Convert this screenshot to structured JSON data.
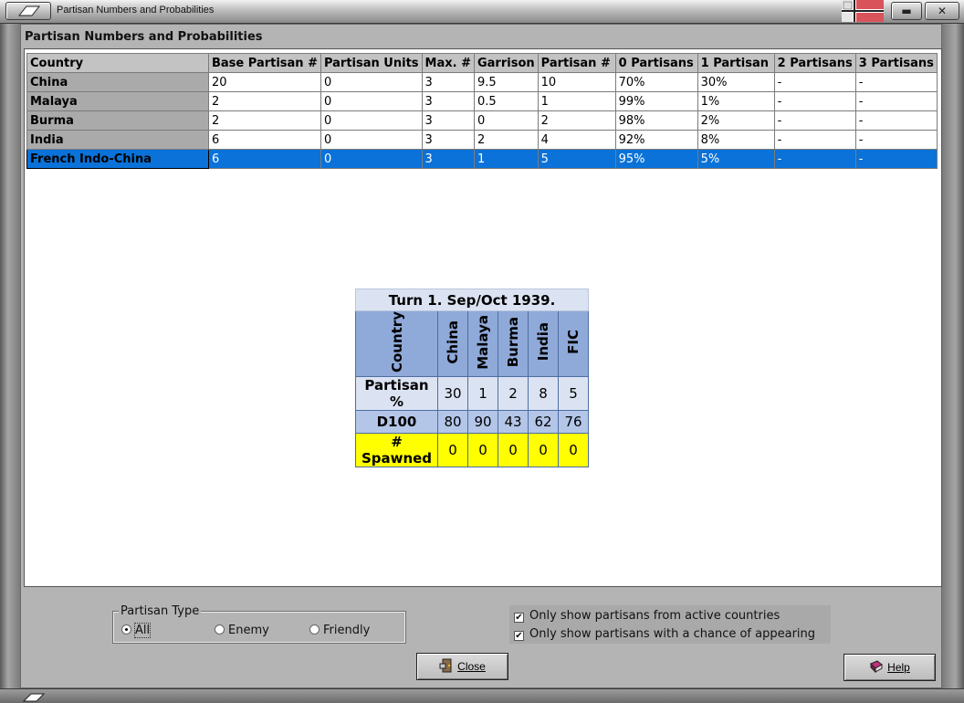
{
  "window": {
    "title": "Partisan Numbers and Probabilities",
    "min_glyph": "▬",
    "close_glyph": "✕"
  },
  "panel": {
    "heading": "Partisan Numbers and Probabilities"
  },
  "grid": {
    "columns": [
      "Country",
      "Base Partisan #",
      "Partisan Units",
      "Max. #",
      "Garrison",
      "Partisan #",
      "0 Partisans",
      "1 Partisan",
      "2 Partisans",
      "3 Partisans"
    ],
    "rows": [
      [
        "China",
        "20",
        "0",
        "3",
        "9.5",
        "10",
        "70%",
        "30%",
        "-",
        "-"
      ],
      [
        "Malaya",
        "2",
        "0",
        "3",
        "0.5",
        "1",
        "99%",
        "1%",
        "-",
        "-"
      ],
      [
        "Burma",
        "2",
        "0",
        "3",
        "0",
        "2",
        "98%",
        "2%",
        "-",
        "-"
      ],
      [
        "India",
        "6",
        "0",
        "3",
        "2",
        "4",
        "92%",
        "8%",
        "-",
        "-"
      ],
      [
        "French Indo-China",
        "6",
        "0",
        "3",
        "1",
        "5",
        "95%",
        "5%",
        "-",
        "-"
      ]
    ],
    "selected_row": "French Indo-China"
  },
  "summary": {
    "title": "Turn 1.  Sep/Oct 1939.",
    "header_label": "Country",
    "countries": [
      "China",
      "Malaya",
      "Burma",
      "India",
      "FIC"
    ],
    "rows": [
      {
        "label": "Partisan %",
        "values": [
          "30",
          "1",
          "2",
          "8",
          "5"
        ]
      },
      {
        "label": "D100",
        "values": [
          "80",
          "90",
          "43",
          "62",
          "76"
        ]
      },
      {
        "label": "# Spawned",
        "values": [
          "0",
          "0",
          "0",
          "0",
          "0"
        ]
      }
    ]
  },
  "partisan_type": {
    "title": "Partisan Type",
    "options": [
      "All",
      "Enemy",
      "Friendly"
    ],
    "selected": "All"
  },
  "filters": {
    "active_countries": {
      "label": "Only show partisans from active countries",
      "checked": true
    },
    "chance_of_appearing": {
      "label": "Only show partisans with a chance of appearing",
      "checked": true
    },
    "check_glyph": "✔"
  },
  "buttons": {
    "close": "Close",
    "help": "Help"
  },
  "colors": {
    "selection": "#0a72d8",
    "spawned_row": "#ffff00",
    "summary_header": "#8fa9d9"
  }
}
